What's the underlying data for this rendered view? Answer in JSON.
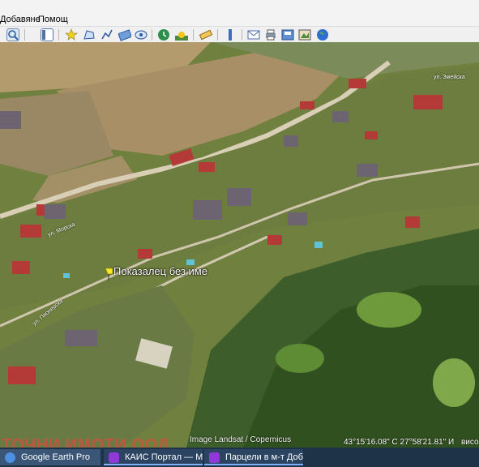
{
  "menu": {
    "items": [
      "Добавяне",
      "Помощ"
    ]
  },
  "toolbar": {
    "buttons": [
      "search-icon",
      "sidebar-icon",
      "placemark-icon",
      "polygon-icon",
      "path-icon",
      "image-overlay-icon",
      "record-tour-icon",
      "historical-imagery-icon",
      "sunlight-icon",
      "planets-icon",
      "ruler-icon",
      "email-icon",
      "print-icon",
      "save-image-icon",
      "view-in-maps-icon",
      "earth-icon"
    ]
  },
  "map": {
    "placemark_label": "Показалец без име",
    "attribution": "Image Landsat / Copernicus",
    "watermark": "ТОЧНИ ИМОТИ ООД",
    "coordinates": "43°15'16.08\" С    27°58'21.81\" И",
    "altitude_prefix": "висо",
    "road_labels": [
      "ул. Морска",
      "ул. Пионерска",
      "ул. Змейска"
    ]
  },
  "taskbar": {
    "tasks": [
      {
        "label": "Google Earth Pro",
        "icon": "google-earth-icon"
      },
      {
        "label": "КАИС Портал — Mo...",
        "icon": "firefox-icon"
      },
      {
        "label": "Парцели в м-т Добр...",
        "icon": "firefox-icon"
      }
    ]
  }
}
